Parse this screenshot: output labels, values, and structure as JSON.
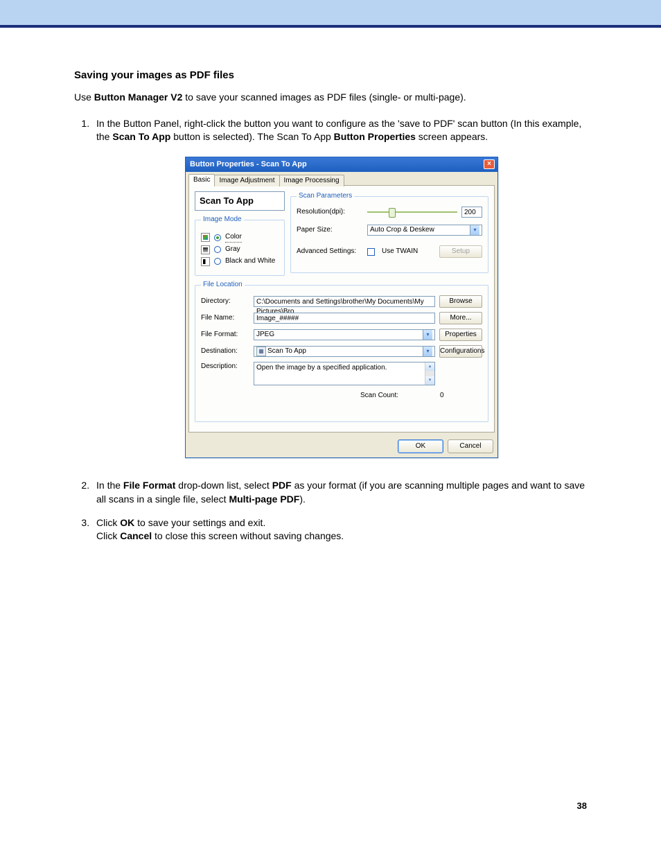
{
  "page": {
    "section_title": "Saving your images as PDF files",
    "intro_a": "Use ",
    "intro_b_bold": "Button Manager V2",
    "intro_c": " to save your scanned images as PDF files (single- or multi-page).",
    "step1_a": "In the Button Panel, right-click the button you want to configure as the 'save to PDF' scan button (In this example, the ",
    "step1_b_bold": "Scan To App",
    "step1_c": " button is selected). The Scan To App ",
    "step1_d_bold": "Button Properties",
    "step1_e": " screen appears.",
    "step2_a": "In the ",
    "step2_b_bold": "File Format",
    "step2_c": " drop-down list, select ",
    "step2_d_bold": "PDF",
    "step2_e": " as your format (if you are scanning multiple pages and want to save all scans in a single file, select ",
    "step2_f_bold": "Multi-page PDF",
    "step2_g": ").",
    "step3_a": "Click ",
    "step3_b_bold": "OK",
    "step3_c": " to save your settings and exit.",
    "step3_d": "Click ",
    "step3_e_bold": "Cancel",
    "step3_f": " to close this screen without saving changes.",
    "page_number": "38"
  },
  "dialog": {
    "title": "Button Properties - Scan To App",
    "tabs": {
      "basic": "Basic",
      "image_adj": "Image Adjustment",
      "image_proc": "Image Processing"
    },
    "button_name": "Scan To App",
    "image_mode": {
      "legend": "Image Mode",
      "color": "Color",
      "gray": "Gray",
      "bw": "Black and White"
    },
    "scan_params": {
      "legend": "Scan Parameters",
      "resolution_label": "Resolution(dpi):",
      "resolution_value": "200",
      "paper_size_label": "Paper Size:",
      "paper_size_value": "Auto Crop & Deskew",
      "adv_label": "Advanced Settings:",
      "use_twain": "Use TWAIN",
      "setup_btn": "Setup"
    },
    "file_location": {
      "legend": "File Location",
      "directory_label": "Directory:",
      "directory_value": "C:\\Documents and Settings\\brother\\My Documents\\My Pictures\\Bro",
      "browse_btn": "Browse",
      "filename_label": "File Name:",
      "filename_value": "Image_#####",
      "more_btn": "More...",
      "fileformat_label": "File Format:",
      "fileformat_value": "JPEG",
      "properties_btn": "Properties",
      "destination_label": "Destination:",
      "destination_value": "Scan To App",
      "config_btn": "Configurations",
      "description_label": "Description:",
      "description_value": "Open the image by a specified application.",
      "scan_count_label": "Scan Count:",
      "scan_count_value": "0"
    },
    "footer": {
      "ok": "OK",
      "cancel": "Cancel"
    }
  }
}
